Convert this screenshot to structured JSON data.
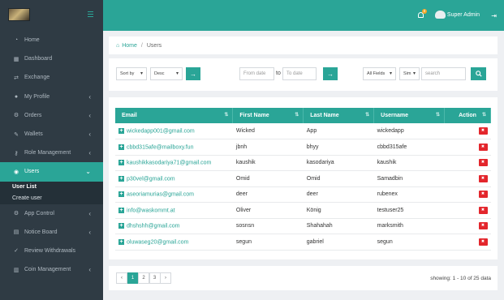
{
  "sidebar": {
    "items": [
      {
        "label": "Home",
        "icon": "tachometer-icon",
        "chev": false
      },
      {
        "label": "Dashboard",
        "icon": "dashboard-icon",
        "chev": false
      },
      {
        "label": "Exchange",
        "icon": "exchange-icon",
        "chev": false
      },
      {
        "label": "My Profile",
        "icon": "user-icon",
        "chev": true
      },
      {
        "label": "Orders",
        "icon": "gear-icon",
        "chev": true
      },
      {
        "label": "Wallets",
        "icon": "pencil-icon",
        "chev": true
      },
      {
        "label": "Role Management",
        "icon": "key-icon",
        "chev": true
      },
      {
        "label": "Users",
        "icon": "users-icon",
        "chev": true,
        "active": true
      },
      {
        "label": "App Control",
        "icon": "gear-icon",
        "chev": true
      },
      {
        "label": "Notice Board",
        "icon": "clipboard-icon",
        "chev": true
      },
      {
        "label": "Review Withdrawals",
        "icon": "check-icon",
        "chev": false
      },
      {
        "label": "Coin Management",
        "icon": "bank-icon",
        "chev": true
      }
    ],
    "sub": [
      "User List",
      "Create user"
    ]
  },
  "topbar": {
    "notif_count": "0",
    "admin_name": "Super Admin"
  },
  "breadcrumb": {
    "home": "Home",
    "current": "Users"
  },
  "filters": {
    "sort_by": "Sort by",
    "order": "Desc",
    "from_placeholder": "From date",
    "to_label": "to",
    "to_placeholder": "To date",
    "fields": "All Fields",
    "match": "Sim",
    "search_placeholder": "search"
  },
  "table": {
    "headers": [
      "Email",
      "First Name",
      "Last Name",
      "Username",
      "Action"
    ],
    "rows": [
      [
        "wickedapp001@gmail.com",
        "Wicked",
        "App",
        "wickedapp"
      ],
      [
        "cbbd315afe@mailboxy.fun",
        "jbnh",
        "bhyy",
        "cbbd315afe"
      ],
      [
        "kaushikkasodariya71@gmail.com",
        "kaushik",
        "kasodariya",
        "kaushik"
      ],
      [
        "p30vel@gmail.com",
        "Omid",
        "Omid",
        "Samadbin"
      ],
      [
        "aseoriamurias@gmail.com",
        "deer",
        "deer",
        "rubenex"
      ],
      [
        "info@waskommt.at",
        "Oliver",
        "König",
        "testuser25"
      ],
      [
        "dhshshh@gmail.com",
        "sosnsn",
        "Shahahah",
        "marksmith"
      ],
      [
        "oluwaseg20@gmail.com",
        "segun",
        "gabriel",
        "segun"
      ]
    ]
  },
  "pagination": {
    "prev": "‹",
    "pages": [
      "1",
      "2",
      "3"
    ],
    "next": "›",
    "showing": "showing: 1 - 10 of 25 data"
  },
  "colors": {
    "accent": "#2aa597",
    "sidebar": "#2f3b44",
    "danger": "#e3262c"
  }
}
